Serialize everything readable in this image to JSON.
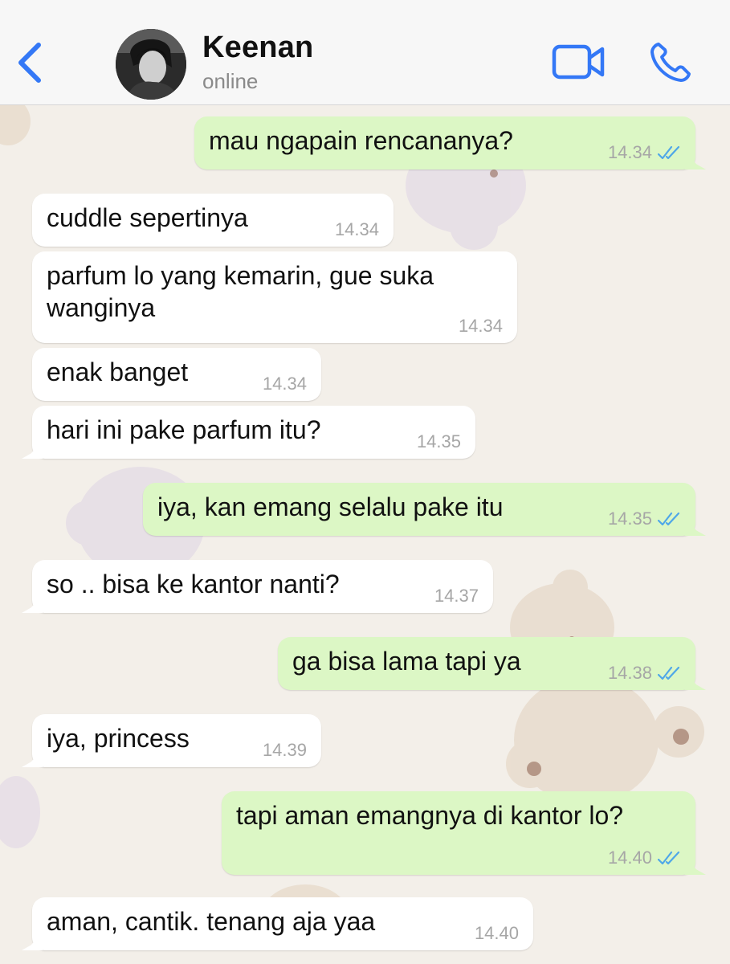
{
  "header": {
    "back_icon": "chevron-left-icon",
    "contact_name": "Keenan",
    "contact_status": "online",
    "video_icon": "video-camera-icon",
    "call_icon": "phone-icon",
    "accent_color": "#3478f6"
  },
  "colors": {
    "incoming_bubble": "#ffffff",
    "outgoing_bubble": "#dcf7c5",
    "read_ticks": "#4fa7e8",
    "timestamp": "#a6a6a6"
  },
  "messages": [
    {
      "from": "me",
      "text": "mau ngapain rencananya?",
      "time": "14.34",
      "read": true
    },
    {
      "from": "them",
      "text": "cuddle sepertinya",
      "time": "14.34"
    },
    {
      "from": "them",
      "text": "parfum lo yang kemarin, gue suka\nwanginya",
      "time": "14.34"
    },
    {
      "from": "them",
      "text": "enak banget",
      "time": "14.34"
    },
    {
      "from": "them",
      "text": "hari ini pake parfum itu?",
      "time": "14.35"
    },
    {
      "from": "me",
      "text": "iya, kan emang selalu pake itu",
      "time": "14.35",
      "read": true
    },
    {
      "from": "them",
      "text": "so .. bisa ke kantor nanti?",
      "time": "14.37"
    },
    {
      "from": "me",
      "text": "ga bisa lama tapi ya",
      "time": "14.38",
      "read": true
    },
    {
      "from": "them",
      "text": "iya, princess",
      "time": "14.39"
    },
    {
      "from": "me",
      "text": "tapi aman emangnya di kantor lo?",
      "time": "14.40",
      "read": true
    },
    {
      "from": "them",
      "text": "aman, cantik. tenang aja yaa",
      "time": "14.40"
    }
  ]
}
